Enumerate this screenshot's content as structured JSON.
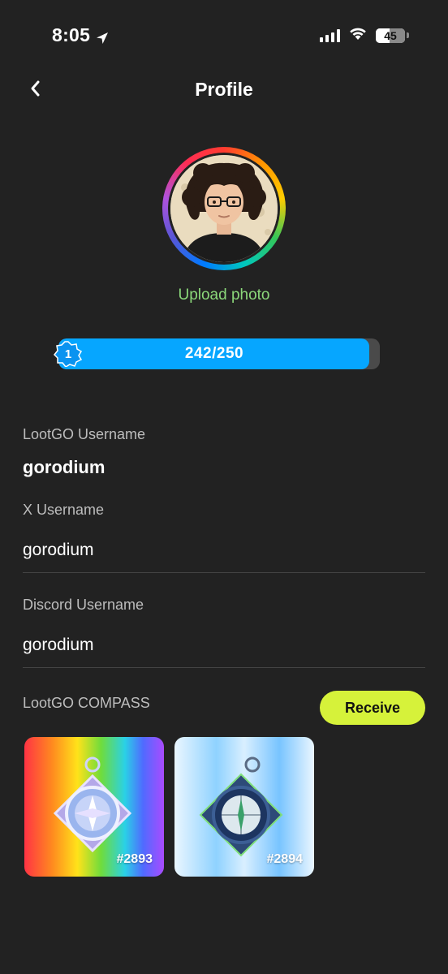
{
  "status_bar": {
    "time": "8:05",
    "battery": "45",
    "location_icon": "location-arrow-icon",
    "signal_icon": "cellular-signal-icon",
    "wifi_icon": "wifi-icon"
  },
  "header": {
    "back_icon": "chevron-left-icon",
    "title": "Profile"
  },
  "profile": {
    "upload_label": "Upload photo",
    "level": "1",
    "xp_text": "242/250",
    "xp_current": 242,
    "xp_max": 250
  },
  "fields": {
    "lootgo_username_label": "LootGO Username",
    "lootgo_username": "gorodium",
    "x_username_label": "X Username",
    "x_username": "gorodium",
    "discord_username_label": "Discord Username",
    "discord_username": "gorodium"
  },
  "compass": {
    "section_label": "LootGO COMPASS",
    "receive_label": "Receive",
    "items": [
      {
        "number": "#2893"
      },
      {
        "number": "#2894"
      }
    ]
  },
  "colors": {
    "background": "#222222",
    "accent_green": "#8bd87a",
    "xp_blue": "#06a6ff",
    "receive_lime": "#d6f23a"
  }
}
